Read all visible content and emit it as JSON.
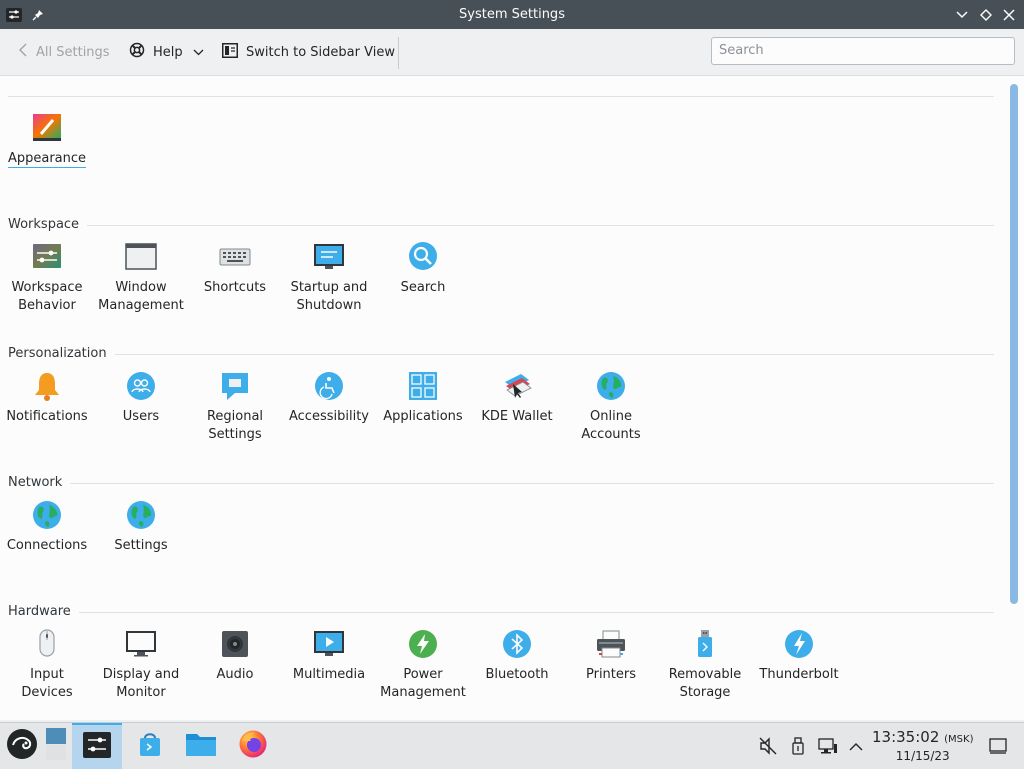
{
  "window": {
    "title": "System Settings"
  },
  "toolbar": {
    "all_settings": "All Settings",
    "help": "Help",
    "switch": "Switch to Sidebar View",
    "search_placeholder": "Search"
  },
  "sections": {
    "workspace": "Workspace",
    "personalization": "Personalization",
    "network": "Network",
    "hardware": "Hardware"
  },
  "items": {
    "appearance": "Appearance",
    "workspace_behavior": [
      "Workspace",
      "Behavior"
    ],
    "window_management": [
      "Window",
      "Management"
    ],
    "shortcuts": "Shortcuts",
    "startup": [
      "Startup and",
      "Shutdown"
    ],
    "search": "Search",
    "notifications": "Notifications",
    "users": "Users",
    "regional": [
      "Regional",
      "Settings"
    ],
    "accessibility": "Accessibility",
    "applications": "Applications",
    "kde_wallet": "KDE Wallet",
    "online_accounts": [
      "Online",
      "Accounts"
    ],
    "connections": "Connections",
    "net_settings": "Settings",
    "input_devices": [
      "Input",
      "Devices"
    ],
    "display": [
      "Display and",
      "Monitor"
    ],
    "audio": "Audio",
    "multimedia": "Multimedia",
    "power": [
      "Power",
      "Management"
    ],
    "bluetooth": "Bluetooth",
    "printers": "Printers",
    "removable": [
      "Removable",
      "Storage"
    ],
    "thunderbolt": "Thunderbolt"
  },
  "taskbar": {
    "time": "13:35:02",
    "tz": "(MSK)",
    "date": "11/15/23"
  },
  "colors": {
    "accent": "#3daee9",
    "titlebar": "#475057"
  }
}
